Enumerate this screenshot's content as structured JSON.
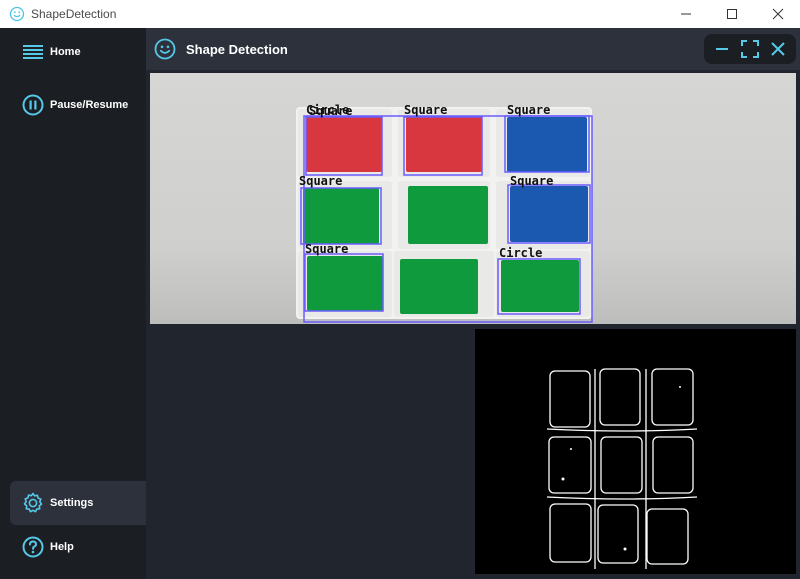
{
  "window": {
    "title": "ShapeDetection",
    "controls": {
      "minimize_icon": "minimize-icon",
      "maximize_icon": "maximize-icon",
      "close_icon": "close-icon"
    }
  },
  "sidebar": {
    "items": [
      {
        "id": "home",
        "label": "Home",
        "icon": "menu-icon"
      },
      {
        "id": "pause",
        "label": "Pause/Resume",
        "icon": "pause-circle-icon"
      },
      {
        "id": "settings",
        "label": "Settings",
        "icon": "gear-icon",
        "active": true
      },
      {
        "id": "help",
        "label": "Help",
        "icon": "help-circle-icon"
      }
    ]
  },
  "header": {
    "title": "Shape Detection",
    "icon": "smile-icon",
    "controls": [
      "minimize-icon",
      "fullscreen-icon",
      "close-icon"
    ]
  },
  "camera_view": {
    "detections": [
      {
        "label": "Circle",
        "color": "red"
      },
      {
        "label": "Square",
        "color": "red"
      },
      {
        "label": "Square",
        "color": "blue"
      },
      {
        "label": "Square",
        "color": "green"
      },
      {
        "label": "Square",
        "color": "blue"
      },
      {
        "label": "Square",
        "color": "green"
      },
      {
        "label": "Circle",
        "color": "green"
      }
    ],
    "overlay_text_extra": "Square",
    "box_color": "#6a5cff"
  },
  "colors": {
    "sidebar_bg": "#1b1e23",
    "header_bg": "#2c313c",
    "content_bg": "#21252d",
    "accent": "#56c8e8",
    "cube_red": "#d9373f",
    "cube_blue": "#1b58b0",
    "cube_green": "#0f9a3e"
  }
}
